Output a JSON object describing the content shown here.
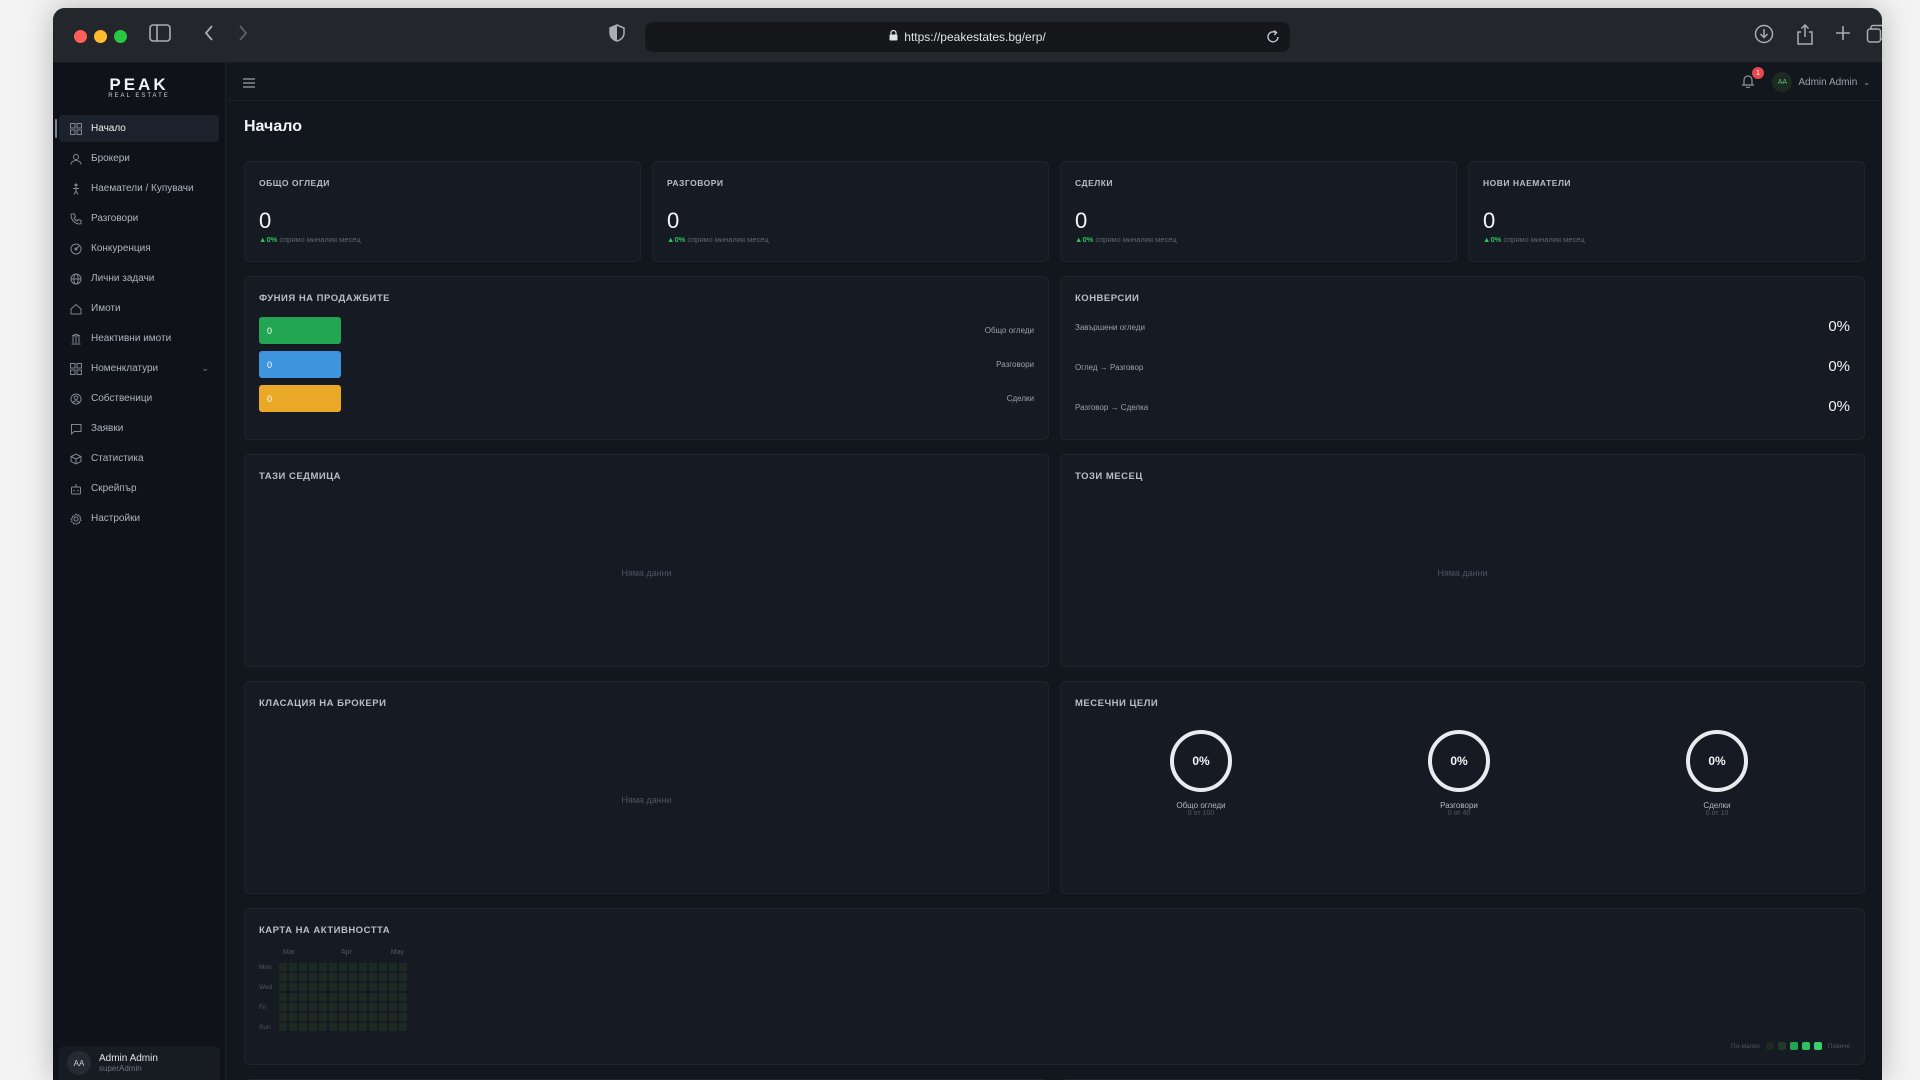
{
  "browser": {
    "url": "https://peakestates.bg/erp/"
  },
  "sidebar": {
    "logo_main": "PEAK",
    "logo_sub": "REAL ESTATE",
    "items": [
      {
        "label": "Начало",
        "icon": "grid-icon",
        "active": true
      },
      {
        "label": "Брокери",
        "icon": "user-icon"
      },
      {
        "label": "Наематели / Купувачи",
        "icon": "person-icon"
      },
      {
        "label": "Разговори",
        "icon": "phone-icon"
      },
      {
        "label": "Конкуренция",
        "icon": "target-icon"
      },
      {
        "label": "Лични задачи",
        "icon": "globe-icon"
      },
      {
        "label": "Имоти",
        "icon": "home-icon"
      },
      {
        "label": "Неактивни имоти",
        "icon": "archive-icon"
      },
      {
        "label": "Номенклатури",
        "icon": "grid-icon",
        "has_submenu": true
      },
      {
        "label": "Собственици",
        "icon": "user-circle-icon"
      },
      {
        "label": "Заявки",
        "icon": "message-icon"
      },
      {
        "label": "Статистика",
        "icon": "cube-icon"
      },
      {
        "label": "Скрейпър",
        "icon": "bot-icon"
      },
      {
        "label": "Настройки",
        "icon": "gear-icon"
      }
    ],
    "user": {
      "initials": "AA",
      "name": "Admin Admin",
      "role": "superAdmin"
    }
  },
  "topbar": {
    "notification_count": "1",
    "user_initials": "AA",
    "user_name": "Admin Admin"
  },
  "page": {
    "title": "Начало"
  },
  "stats": [
    {
      "label": "ОБЩО ОГЛЕДИ",
      "value": "0",
      "delta": "0%",
      "delta_text": "спрямо миналия месец"
    },
    {
      "label": "РАЗГОВОРИ",
      "value": "0",
      "delta": "0%",
      "delta_text": "спрямо миналия месец"
    },
    {
      "label": "СДЕЛКИ",
      "value": "0",
      "delta": "0%",
      "delta_text": "спрямо миналия месец"
    },
    {
      "label": "НОВИ НАЕМАТЕЛИ",
      "value": "0",
      "delta": "0%",
      "delta_text": "спрямо миналия месец"
    }
  ],
  "funnel": {
    "title": "ФУНИЯ НА ПРОДАЖБИТЕ",
    "rows": [
      {
        "value": "0",
        "label": "Общо огледи",
        "color": "#22a651"
      },
      {
        "value": "0",
        "label": "Разговори",
        "color": "#3f95dd"
      },
      {
        "value": "0",
        "label": "Сделки",
        "color": "#e9a826"
      }
    ]
  },
  "conversions": {
    "title": "КОНВЕРСИИ",
    "rows": [
      {
        "label": "Завършени огледи",
        "value": "0%"
      },
      {
        "label": "Оглед → Разговор",
        "value": "0%"
      },
      {
        "label": "Разговор → Сделка",
        "value": "0%"
      }
    ]
  },
  "this_week": {
    "title": "ТАЗИ СЕДМИЦА",
    "empty": "Няма данни"
  },
  "this_month": {
    "title": "ТОЗИ МЕСЕЦ",
    "empty": "Няма данни"
  },
  "broker_ranking": {
    "title": "КЛАСАЦИЯ НА БРОКЕРИ",
    "empty": "Няма данни"
  },
  "monthly_goals": {
    "title": "МЕСЕЧНИ ЦЕЛИ",
    "goals": [
      {
        "percent": "0%",
        "label": "Общо огледи",
        "sub": "0 от 100"
      },
      {
        "percent": "0%",
        "label": "Разговори",
        "sub": "0 от 40"
      },
      {
        "percent": "0%",
        "label": "Сделки",
        "sub": "0 от 10"
      }
    ]
  },
  "activity_map": {
    "title": "КАРТА НА АКТИВНОСТТА",
    "months": [
      "Mar",
      "Apr",
      "May"
    ],
    "days": [
      "Mon",
      "Wed",
      "Fri",
      "Sun"
    ],
    "legend_less": "По-малко",
    "legend_more": "Повече",
    "colors": [
      "#1c2a22",
      "#1f3a28",
      "#22a651",
      "#2fbf5f",
      "#3ad06b"
    ]
  }
}
